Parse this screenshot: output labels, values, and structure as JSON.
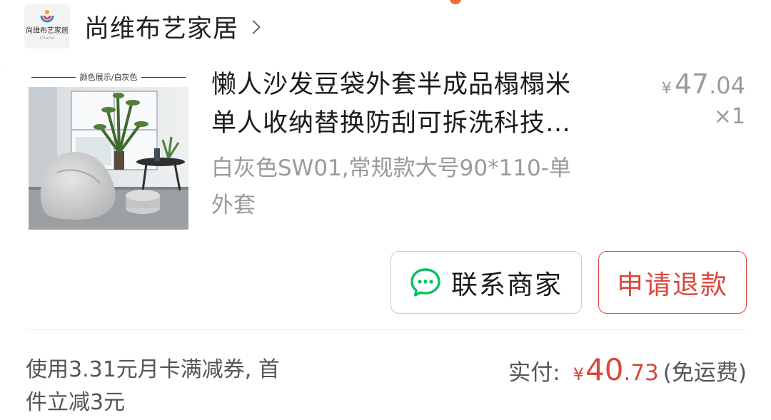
{
  "shop": {
    "logo_name": "尚维布艺家居",
    "logo_sub": "Chanvi",
    "name": "尚维布艺家居"
  },
  "product": {
    "thumb_caption": "颜色展示/白灰色",
    "title_line1": "懒人沙发豆袋外套半成品榻榻米",
    "title_line2": "单人收纳替换防刮可拆洗科技…",
    "spec_line1": "白灰色SW01,常规款大号90*110-单",
    "spec_line2": "外套",
    "price_symbol": "¥",
    "price_int": "47",
    "price_dec": ".04",
    "quantity": "×1"
  },
  "actions": {
    "contact_label": "联系商家",
    "refund_label": "申请退款"
  },
  "summary": {
    "coupon_line1": "使用3.31元月卡满减券, 首",
    "coupon_line2": "件立减3元",
    "paid_label": "实付:",
    "paid_symbol": "¥",
    "paid_int": "40",
    "paid_dec": ".73",
    "paid_note": "(免运费)"
  },
  "colors": {
    "accent_red": "#d9483b",
    "wechat_green": "#07c160",
    "muted_gray": "#9a9a9a"
  },
  "icons": {
    "chat": "chat-bubble-icon",
    "chevron": "chevron-right-icon"
  }
}
